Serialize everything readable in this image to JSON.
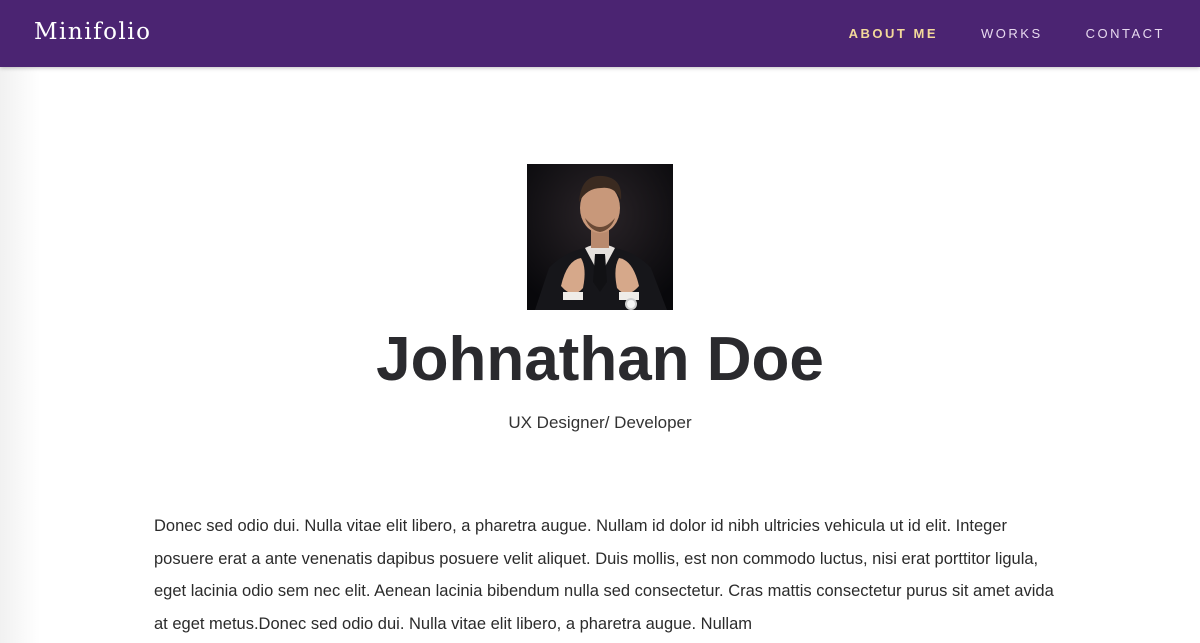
{
  "navbar": {
    "brand": "Minifolio",
    "links": [
      {
        "label": "ABOUT ME",
        "active": true
      },
      {
        "label": "WORKS",
        "active": false
      },
      {
        "label": "CONTACT",
        "active": false
      }
    ]
  },
  "profile": {
    "name": "Johnathan Doe",
    "role": "UX Designer/ Developer",
    "bio": "Donec sed odio dui. Nulla vitae elit libero, a pharetra augue. Nullam id dolor id nibh ultricies vehicula ut id elit. Integer posuere erat a ante venenatis dapibus posuere velit aliquet. Duis mollis, est non commodo luctus, nisi erat porttitor ligula, eget lacinia odio sem nec elit. Aenean lacinia bibendum nulla sed consectetur. Cras mattis consectetur purus sit amet avida at eget metus.Donec sed odio dui. Nulla vitae elit libero, a pharetra augue. Nullam"
  },
  "colors": {
    "navbar_bg": "#4b2472",
    "nav_active": "#f3d99a",
    "nav_text": "#e7d9ef",
    "heading": "#2a2a2e"
  }
}
